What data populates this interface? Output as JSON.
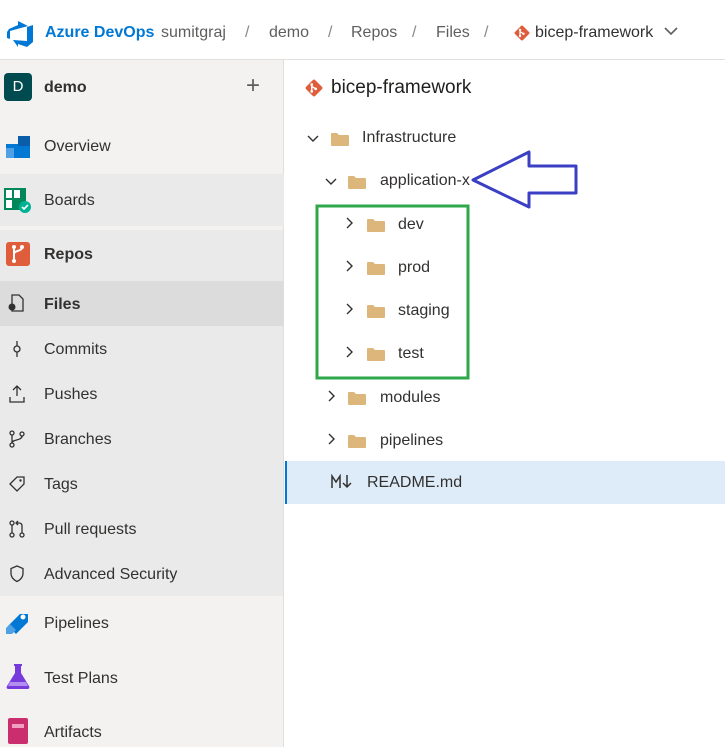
{
  "header": {
    "brand": "Azure DevOps",
    "breadcrumbs": [
      "sumitgraj",
      "demo",
      "Repos",
      "Files"
    ],
    "repo": "bicep-framework"
  },
  "sidebar": {
    "project": {
      "initial": "D",
      "name": "demo",
      "add": "+"
    },
    "items": [
      {
        "label": "Overview"
      },
      {
        "label": "Boards"
      },
      {
        "label": "Repos"
      },
      {
        "label": "Files"
      },
      {
        "label": "Commits"
      },
      {
        "label": "Pushes"
      },
      {
        "label": "Branches"
      },
      {
        "label": "Tags"
      },
      {
        "label": "Pull requests"
      },
      {
        "label": "Advanced Security"
      },
      {
        "label": "Pipelines"
      },
      {
        "label": "Test Plans"
      },
      {
        "label": "Artifacts"
      }
    ]
  },
  "main": {
    "repo_title": "bicep-framework",
    "tree": [
      {
        "label": "Infrastructure"
      },
      {
        "label": "application-x"
      },
      {
        "label": "dev"
      },
      {
        "label": "prod"
      },
      {
        "label": "staging"
      },
      {
        "label": "test"
      },
      {
        "label": "modules"
      },
      {
        "label": "pipelines"
      },
      {
        "label": "README.md"
      }
    ]
  },
  "colors": {
    "accent": "#0078d4",
    "folder": "#dcb67a",
    "git": "#e05d3c",
    "arrow": "#3a3fc4",
    "highlight_box": "#2ea84a",
    "selected_row": "#deecf9"
  }
}
